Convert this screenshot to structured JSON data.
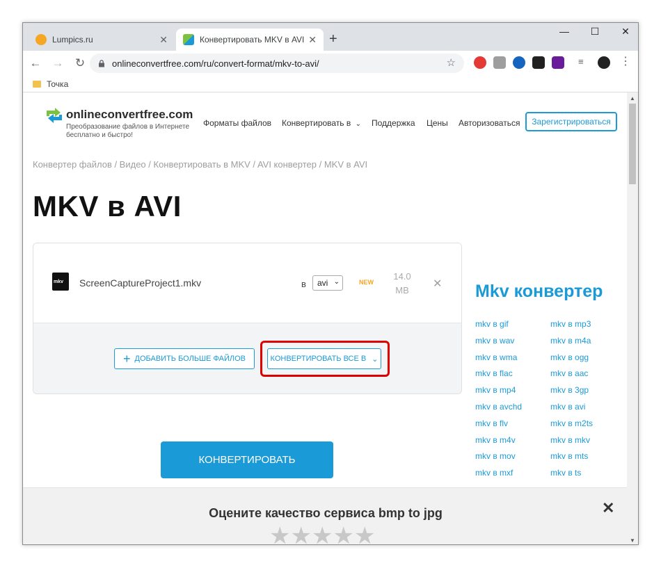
{
  "browser": {
    "tabs": [
      {
        "label": "Lumpics.ru",
        "active": false
      },
      {
        "label": "Конвертировать MKV в AVI онл",
        "active": true
      }
    ],
    "url": "onlineconvertfree.com/ru/convert-format/mkv-to-avi/",
    "bookmark": "Точка"
  },
  "site": {
    "logo_title": "onlineconvertfree.com",
    "logo_sub_1": "Преобразование файлов в Интернете",
    "logo_sub_2": "бесплатно и быстро!",
    "nav": {
      "formats": "Форматы файлов",
      "convert": "Конвертировать в",
      "support": "Поддержка",
      "prices": "Цены",
      "login": "Авторизоваться",
      "register": "Зарегистрироваться"
    }
  },
  "breadcrumb": "Конвертер файлов / Видео / Конвертировать в MKV / AVI конвертер / MKV в AVI",
  "page_title": "MKV в AVI",
  "converter": {
    "file_icon_label": "mkv",
    "file_name": "ScreenCaptureProject1.mkv",
    "to_label": "в",
    "format": "avi",
    "new_badge": "NEW",
    "size_value": "14.0",
    "size_unit": "MB",
    "add_more": "ДОБАВИТЬ БОЛЬШЕ ФАЙЛОВ",
    "convert_all": "КОНВЕРТИРОВАТЬ ВСЕ В",
    "convert": "КОНВЕРТИРОВАТЬ"
  },
  "sidebar": {
    "title": "Mkv конвертер",
    "col1": [
      "mkv в gif",
      "mkv в wav",
      "mkv в wma",
      "mkv в flac",
      "mkv в mp4",
      "mkv в avchd",
      "mkv в flv",
      "mkv в m4v",
      "mkv в mov",
      "mkv в mxf"
    ],
    "col2": [
      "mkv в mp3",
      "mkv в m4a",
      "mkv в ogg",
      "mkv в aac",
      "mkv в 3gp",
      "mkv в avi",
      "mkv в m2ts",
      "mkv в mkv",
      "mkv в mts",
      "mkv в ts"
    ]
  },
  "rating": {
    "title": "Оцените качество сервиса bmp to jpg",
    "stars_filled": 0,
    "stars_total": 5
  }
}
